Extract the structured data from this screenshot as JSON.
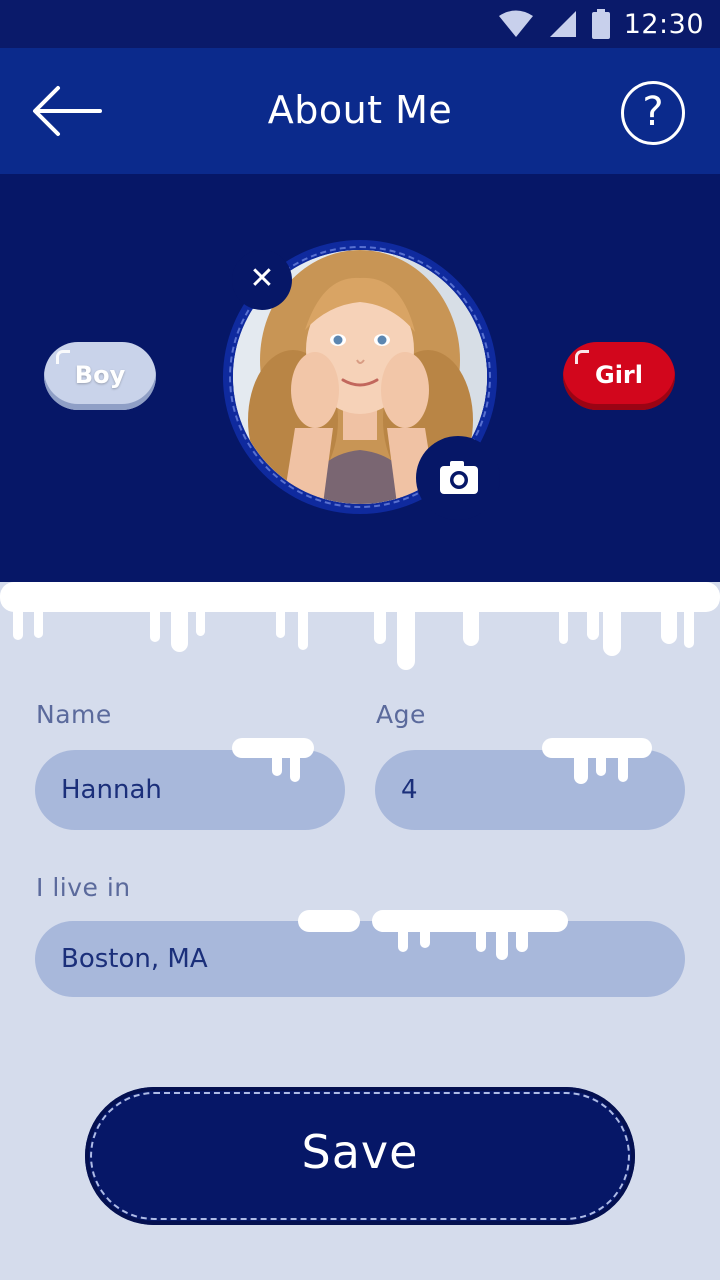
{
  "status_bar": {
    "time": "12:30",
    "icons": [
      "wifi-icon",
      "cellular-signal-icon",
      "battery-icon"
    ]
  },
  "header": {
    "title": "About Me",
    "back_icon": "arrow-left-icon",
    "help_label": "?"
  },
  "profile": {
    "gender_options": [
      {
        "label": "Boy",
        "selected": false
      },
      {
        "label": "Girl",
        "selected": true
      }
    ],
    "remove_label": "✕",
    "camera_icon": "camera-icon"
  },
  "form": {
    "name": {
      "label": "Name",
      "value": "Hannah"
    },
    "age": {
      "label": "Age",
      "value": "4"
    },
    "location": {
      "label": "I live in",
      "value": "Boston, MA"
    }
  },
  "actions": {
    "save_label": "Save"
  },
  "colors": {
    "header": "#0b2a8c",
    "profile_bg": "#061767",
    "page_bg": "#d5dcec",
    "input_bg": "#a8b8db",
    "girl_selected": "#d2061c",
    "boy_unselected": "#c9d3ea"
  }
}
